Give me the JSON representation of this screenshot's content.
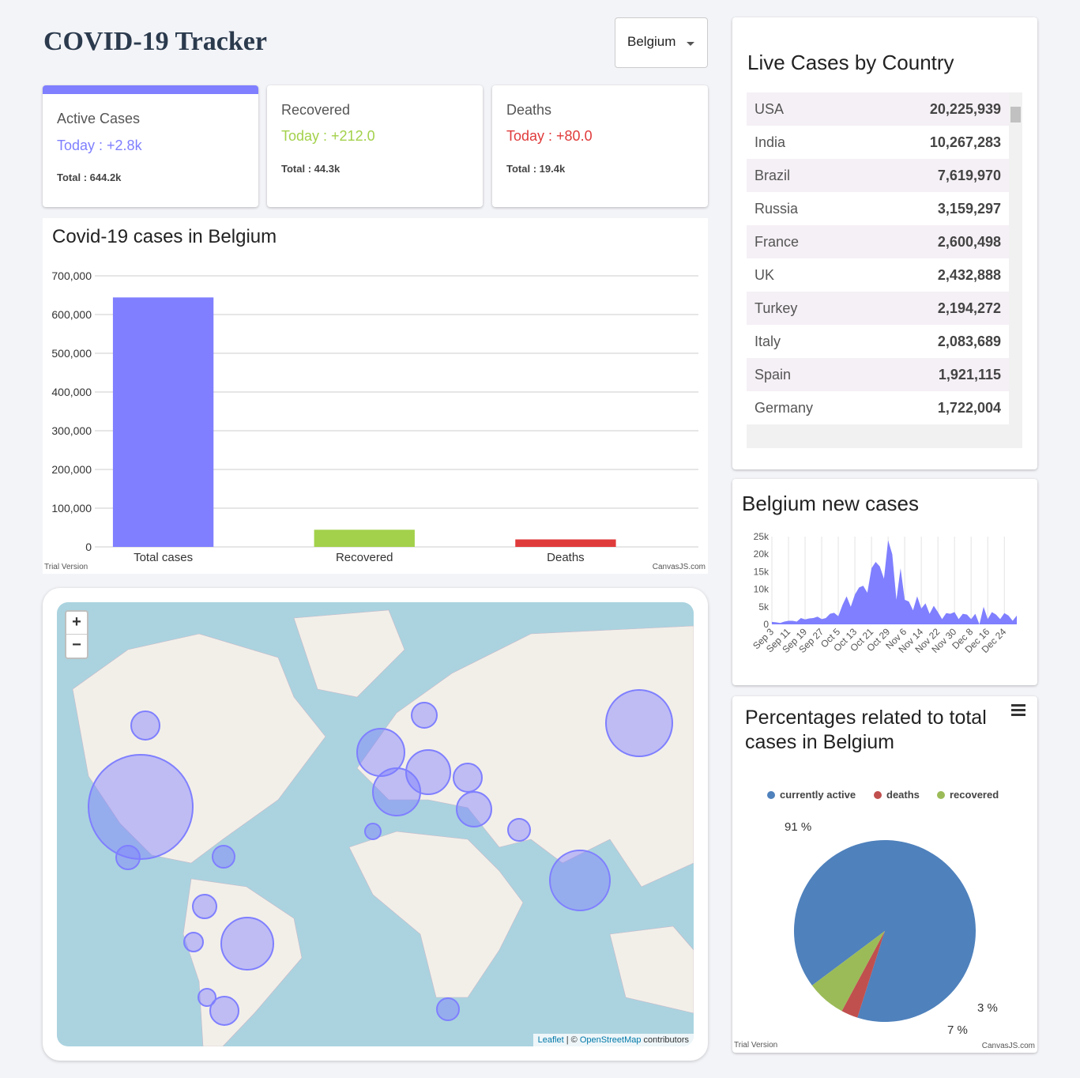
{
  "header": {
    "title": "COVID-19 Tracker",
    "country_select": "Belgium"
  },
  "stats": [
    {
      "label": "Active Cases",
      "today": "Today : +2.8k",
      "total": "Total : 644.2k",
      "color": "#7f7fff"
    },
    {
      "label": "Recovered",
      "today": "Today : +212.0",
      "total": "Total : 44.3k",
      "color": "#a3d14b"
    },
    {
      "label": "Deaths",
      "today": "Today : +80.0",
      "total": "Total : 19.4k",
      "color": "#e03b3b"
    }
  ],
  "live": {
    "title": "Live Cases by Country",
    "rows": [
      {
        "country": "USA",
        "cases": "20,225,939"
      },
      {
        "country": "India",
        "cases": "10,267,283"
      },
      {
        "country": "Brazil",
        "cases": "7,619,970"
      },
      {
        "country": "Russia",
        "cases": "3,159,297"
      },
      {
        "country": "France",
        "cases": "2,600,498"
      },
      {
        "country": "UK",
        "cases": "2,432,888"
      },
      {
        "country": "Turkey",
        "cases": "2,194,272"
      },
      {
        "country": "Italy",
        "cases": "2,083,689"
      },
      {
        "country": "Spain",
        "cases": "1,921,115"
      },
      {
        "country": "Germany",
        "cases": "1,722,004"
      }
    ]
  },
  "map": {
    "zoom_in": "+",
    "zoom_out": "−",
    "attribution_leaflet": "Leaflet",
    "attribution_sep": " | © ",
    "attribution_osm": "OpenStreetMap",
    "attribution_rest": " contributors"
  },
  "watermark": {
    "trial": "Trial Version",
    "canvasjs": "CanvasJS.com"
  },
  "chart_data": [
    {
      "type": "bar",
      "title": "Covid-19 cases in Belgium",
      "categories": [
        "Total cases",
        "Recovered",
        "Deaths"
      ],
      "values": [
        644200,
        44300,
        19400
      ],
      "colors": [
        "#7f7fff",
        "#a3d14b",
        "#e03b3b"
      ],
      "ylim": [
        0,
        700000
      ],
      "yticks": [
        "0",
        "100,000",
        "200,000",
        "300,000",
        "400,000",
        "500,000",
        "600,000",
        "700,000"
      ],
      "grid": true
    },
    {
      "type": "area",
      "title": "Belgium new cases",
      "color": "#7f7fff",
      "ylim": [
        0,
        25000
      ],
      "yticks": [
        "0",
        "5k",
        "10k",
        "15k",
        "20k",
        "25k"
      ],
      "xticks": [
        "Sep 3",
        "Sep 11",
        "Sep 19",
        "Sep 27",
        "Oct 5",
        "Oct 13",
        "Oct 21",
        "Oct 29",
        "Nov 6",
        "Nov 14",
        "Nov 22",
        "Nov 30",
        "Dec 8",
        "Dec 16",
        "Dec 24"
      ],
      "x_start": "Sep 3",
      "x_step_days": 2,
      "values": [
        700,
        600,
        400,
        800,
        1000,
        1000,
        800,
        1800,
        1400,
        1700,
        1800,
        2200,
        1500,
        1800,
        3000,
        3300,
        2300,
        5500,
        8000,
        5000,
        8500,
        10500,
        11000,
        9000,
        16000,
        17800,
        16500,
        13000,
        24000,
        20000,
        7000,
        16000,
        7000,
        6500,
        4000,
        8000,
        4500,
        6000,
        3000,
        5300,
        3500,
        1500,
        3200,
        3000,
        3500,
        1500,
        3000,
        2800,
        1500,
        3000,
        0,
        5000,
        1500,
        3500,
        2800,
        1500,
        3200,
        2500,
        1000,
        2500
      ]
    },
    {
      "type": "pie",
      "title": "Percentages related to total cases in Belgium",
      "legend": [
        "currently active",
        "deaths",
        "recovered"
      ],
      "values": [
        91,
        3,
        7
      ],
      "labels": [
        "91 %",
        "3 %",
        "7 %"
      ],
      "colors": [
        "#4f81bc",
        "#c0504e",
        "#9bbb58"
      ],
      "legend_position": "top"
    }
  ]
}
